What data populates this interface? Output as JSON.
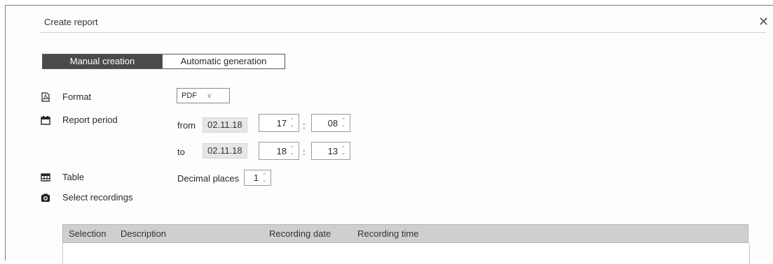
{
  "dialog": {
    "title": "Create report",
    "close_symbol": "✕"
  },
  "tabs": [
    {
      "label": "Manual creation",
      "active": true
    },
    {
      "label": "Automatic generation",
      "active": false
    }
  ],
  "format": {
    "label": "Format",
    "value": "PDF",
    "chevron": "∨"
  },
  "report_period": {
    "label": "Report period",
    "from": {
      "label": "from",
      "date": "02.11.18",
      "hour": "17",
      "minute": "08"
    },
    "to": {
      "label": "to",
      "date": "02.11.18",
      "hour": "18",
      "minute": "13"
    },
    "separator": ":"
  },
  "table_section": {
    "label": "Table",
    "decimal_label": "Decimal places",
    "decimal_value": "1"
  },
  "recordings": {
    "label": "Select recordings",
    "columns": [
      "Selection",
      "Description",
      "Recording date",
      "Recording time"
    ]
  },
  "icons": {
    "format": "pdf-file-icon",
    "period": "calendar-icon",
    "table": "table-grid-icon",
    "recordings": "camera-icon"
  },
  "colors": {
    "active_tab": "#4a4a4a",
    "table_header": "#cfcfcf",
    "date_field": "#e6e6e6"
  }
}
